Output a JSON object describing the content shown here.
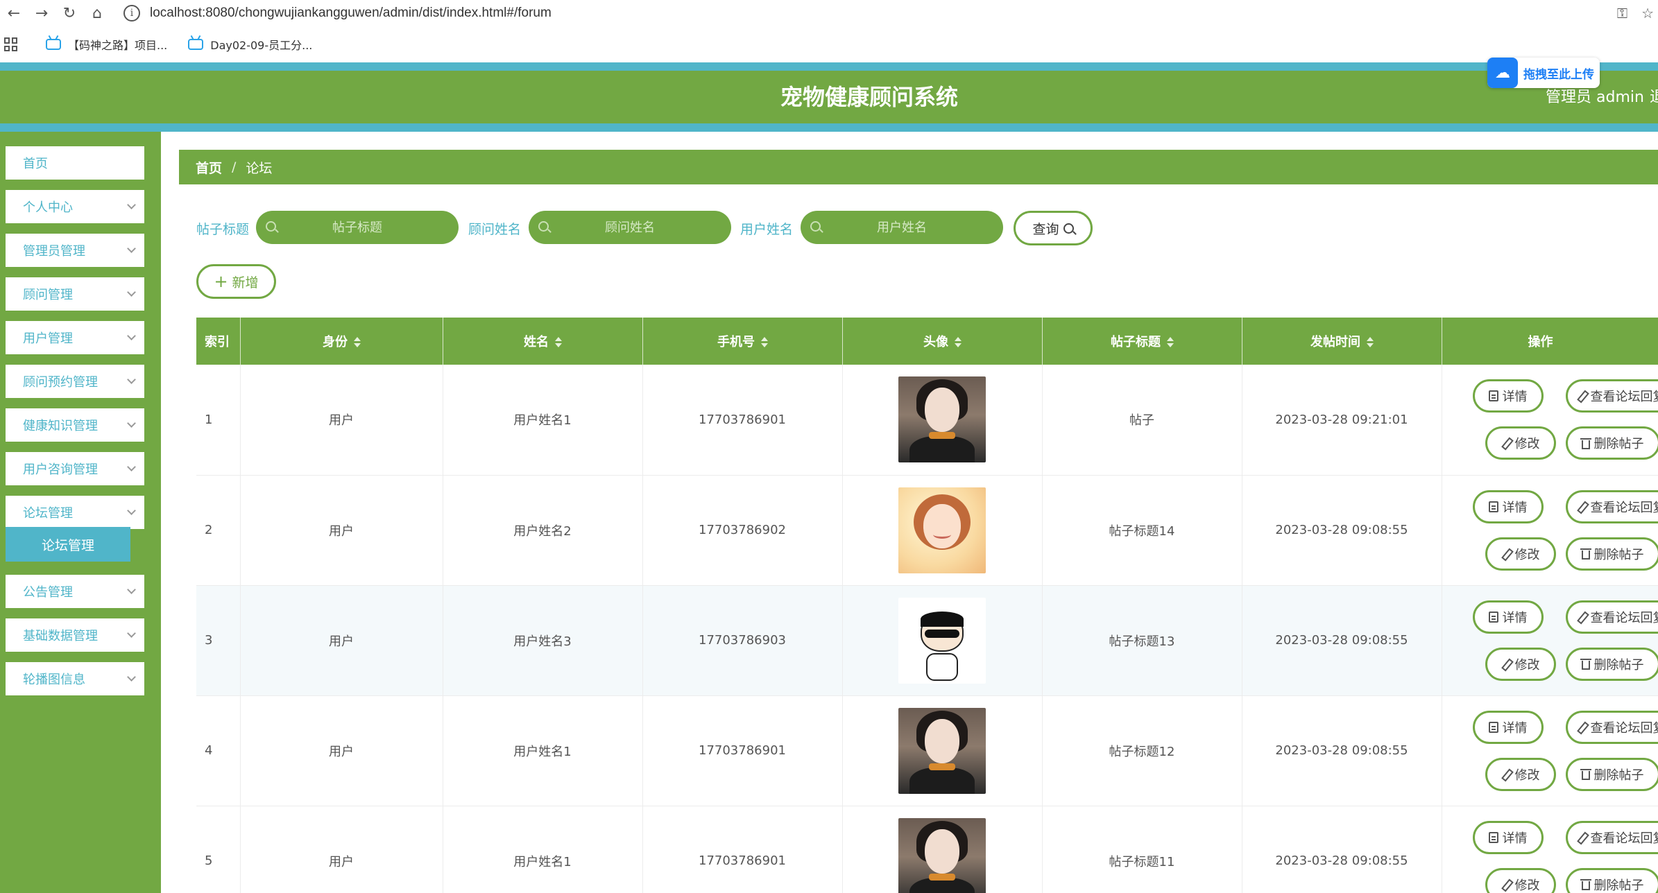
{
  "browser": {
    "url": "localhost:8080/chongwujiankangguwen/admin/dist/index.html#/forum",
    "bookmarks": [
      "【码神之路】项目...",
      "Day02-09-员工分..."
    ]
  },
  "header": {
    "title": "宠物健康顾问系统",
    "user": "管理员 admin",
    "user_extra": "退",
    "upload_widget": "拖拽至此上传"
  },
  "sidebar": {
    "items": [
      {
        "label": "首页",
        "chevron": false
      },
      {
        "label": "个人中心",
        "chevron": true
      },
      {
        "label": "管理员管理",
        "chevron": true
      },
      {
        "label": "顾问管理",
        "chevron": true
      },
      {
        "label": "用户管理",
        "chevron": true
      },
      {
        "label": "顾问预约管理",
        "chevron": true
      },
      {
        "label": "健康知识管理",
        "chevron": true
      },
      {
        "label": "用户咨询管理",
        "chevron": true
      },
      {
        "label": "论坛管理",
        "chevron": true
      },
      {
        "label": "公告管理",
        "chevron": true
      },
      {
        "label": "基础数据管理",
        "chevron": true
      },
      {
        "label": "轮播图信息",
        "chevron": true
      }
    ],
    "active_sub": "论坛管理"
  },
  "breadcrumb": {
    "home": "首页",
    "separator": "/",
    "current": "论坛"
  },
  "search": {
    "title_label": "帖子标题",
    "title_placeholder": "帖子标题",
    "advisor_label": "顾问姓名",
    "advisor_placeholder": "顾问姓名",
    "user_label": "用户姓名",
    "user_placeholder": "用户姓名",
    "query_label": "查询"
  },
  "actions": {
    "add_label": "新增"
  },
  "table": {
    "columns": [
      "索引",
      "身份",
      "姓名",
      "手机号",
      "头像",
      "帖子标题",
      "发帖时间",
      "操作"
    ],
    "rows": [
      {
        "index": "1",
        "role": "用户",
        "name": "用户姓名1",
        "phone": "17703786901",
        "avatar": "portrait-dark",
        "title": "帖子",
        "time": "2023-03-28 09:21:01"
      },
      {
        "index": "2",
        "role": "用户",
        "name": "用户姓名2",
        "phone": "17703786902",
        "avatar": "portrait-warm",
        "title": "帖子标题14",
        "time": "2023-03-28 09:08:55"
      },
      {
        "index": "3",
        "role": "用户",
        "name": "用户姓名3",
        "phone": "17703786903",
        "avatar": "cartoon",
        "title": "帖子标题13",
        "time": "2023-03-28 09:08:55"
      },
      {
        "index": "4",
        "role": "用户",
        "name": "用户姓名1",
        "phone": "17703786901",
        "avatar": "portrait-dark",
        "title": "帖子标题12",
        "time": "2023-03-28 09:08:55"
      },
      {
        "index": "5",
        "role": "用户",
        "name": "用户姓名1",
        "phone": "17703786901",
        "avatar": "portrait-dark",
        "title": "帖子标题11",
        "time": "2023-03-28 09:08:55"
      }
    ],
    "op_labels": {
      "detail": "详情",
      "reply": "查看论坛回复",
      "edit": "修改",
      "delete": "删除帖子"
    }
  },
  "colors": {
    "primary_green": "#72a843",
    "accent_cyan": "#50b5c9"
  }
}
